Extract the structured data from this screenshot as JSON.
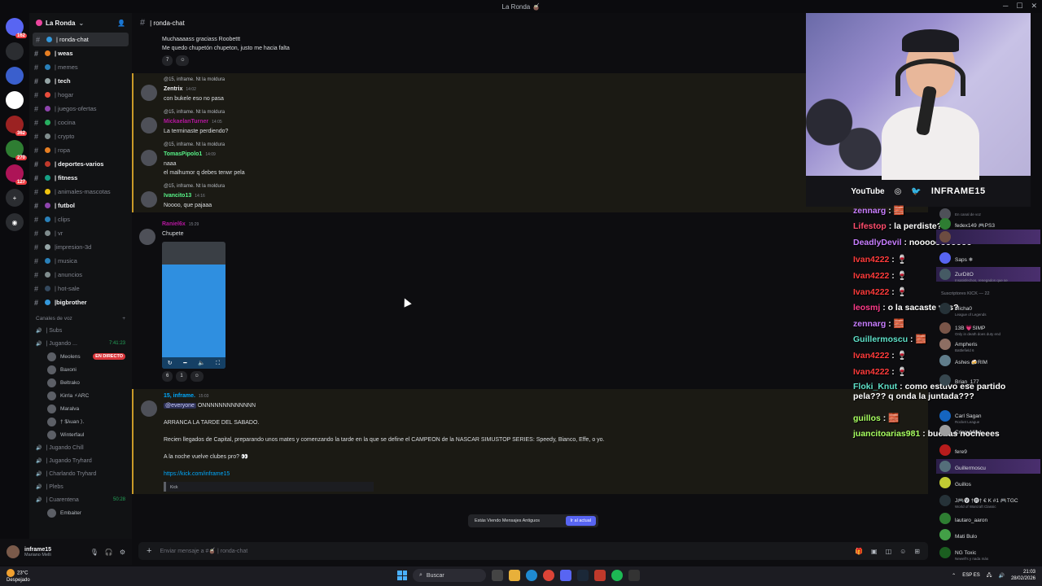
{
  "titlebar": {
    "title": "La Ronda 🧉"
  },
  "rail": {
    "servers": [
      {
        "badge": "162"
      },
      {
        "badge": ""
      },
      {
        "badge": ""
      },
      {
        "badge": ""
      },
      {
        "badge": "362"
      },
      {
        "badge": "270"
      },
      {
        "badge": "127"
      }
    ]
  },
  "sidebar": {
    "guild_name": "La Ronda",
    "channels": [
      {
        "label": "| ronda-chat",
        "state": "active"
      },
      {
        "label": "| weas",
        "state": "bold"
      },
      {
        "label": "| memes",
        "state": "muted"
      },
      {
        "label": "| tech",
        "state": "bold"
      },
      {
        "label": "| hogar",
        "state": "muted"
      },
      {
        "label": "| juegos-ofertas",
        "state": "muted"
      },
      {
        "label": "| cocina",
        "state": "muted"
      },
      {
        "label": "| crypto",
        "state": "muted"
      },
      {
        "label": "| ropa",
        "state": "muted"
      },
      {
        "label": "| deportes-varios",
        "state": "bold"
      },
      {
        "label": "| fitness",
        "state": "bold"
      },
      {
        "label": "| animales-mascotas",
        "state": "muted"
      },
      {
        "label": "| futbol",
        "state": "bold"
      },
      {
        "label": "| clips",
        "state": "muted"
      },
      {
        "label": "| vr",
        "state": "muted"
      },
      {
        "label": "|impresion-3d",
        "state": "muted"
      },
      {
        "label": "| musica",
        "state": "muted"
      },
      {
        "label": "| anuncios",
        "state": "muted"
      },
      {
        "label": "| hot-sale",
        "state": "muted"
      },
      {
        "label": "|bigbrother",
        "state": "bold"
      }
    ],
    "voice_header": "Canales de voz",
    "voice": [
      {
        "label": "| Subs",
        "kind": "channel"
      },
      {
        "label": "| Jugando ...",
        "kind": "channel",
        "timer": "7:41:23"
      },
      {
        "label": "Meolens",
        "kind": "user",
        "live": "EN DIRECTO"
      },
      {
        "label": "Baxoni",
        "kind": "user"
      },
      {
        "label": "Beltrako",
        "kind": "user"
      },
      {
        "label": "Kirrla ⚡ARC",
        "kind": "user"
      },
      {
        "label": "Maralva",
        "kind": "user"
      },
      {
        "label": "† $λuan ⟩.",
        "kind": "user"
      },
      {
        "label": "Winterfaul",
        "kind": "user"
      },
      {
        "label": "| Jugando Chill",
        "kind": "channel"
      },
      {
        "label": "| Jugando Tryhard",
        "kind": "channel"
      },
      {
        "label": "| Charlando Tryhard",
        "kind": "channel"
      },
      {
        "label": "| Plebs",
        "kind": "channel"
      },
      {
        "label": "| Cuarentena",
        "kind": "channel",
        "timer": "50:28"
      },
      {
        "label": "Embaiter",
        "kind": "user"
      }
    ]
  },
  "user_panel": {
    "name": "inframe15",
    "status": "Mariano Melli"
  },
  "chat": {
    "header": "| ronda-chat",
    "messages": [
      {
        "reply": "",
        "author": "",
        "time": "",
        "lines": [
          "Muchaaaass graciass Roobettt",
          "Me quedo chupetón chupeton, justo me hacia falta"
        ],
        "reacts": [
          "7"
        ],
        "hl": false
      },
      {
        "reply": "@15, inframe. Nt la moldura",
        "author": "Zentrix",
        "author_color": "#f2f3f5",
        "time": "14:02",
        "lines": [
          "con  bukele eso no pasa"
        ],
        "hl": true
      },
      {
        "reply": "@15, inframe. Nt la moldura",
        "author": "MickaelanTurner",
        "author_color": "#b5179e",
        "time": "14:05",
        "lines": [
          "La terminaste perdiendo?"
        ],
        "hl": true
      },
      {
        "reply": "@15, inframe. Nt la moldura",
        "author": "TomasPipolo1",
        "author_color": "#57f287",
        "time": "14:09",
        "lines": [
          "naaa",
          "el malhumor q debes tenwr pela"
        ],
        "hl": true
      },
      {
        "reply": "@15, inframe. Nt la moldura",
        "author": "Ivancito13",
        "author_color": "#57f287",
        "time": "14:16",
        "lines": [
          "Noooo, que pajaaa"
        ],
        "hl": true
      },
      {
        "reply": "",
        "author": "Raniel6x",
        "author_color": "#b5179e",
        "time": "15:29",
        "lines": [
          "Chupete"
        ],
        "reacts": [
          "6",
          "1"
        ],
        "image": true,
        "hl": false
      },
      {
        "reply": "",
        "author": "15, inframe.",
        "author_color": "#00a8fc",
        "time": "15:03",
        "mention": "@everyone",
        "lines": [
          "ONNNNNNNNNNNNN",
          "ARRANCA LA TARDE DEL SABADO.",
          "Recien llegados de Capital, preparando unos mates y comenzando la tarde en la que se define el CAMPEON de la NASCAR SIMUSTOP SERIES: Speedy, Bianco, Effe, o yo.",
          "A la noche vuelve clubes pro? 👀"
        ],
        "link": "https://kick.com/inframe15",
        "embed": "Kick",
        "hl": true
      }
    ],
    "jump": {
      "text": "Estás Viendo Mensajes Antiguos",
      "button": "Ir al actual"
    },
    "composer_placeholder": "Enviar mensaje a #🧉 | ronda-chat"
  },
  "overlay": {
    "socials": {
      "youtube": "YouTube",
      "handle": "INFRAME15"
    },
    "lines": [
      {
        "user": "zennarg",
        "user_color": "#c77dff",
        "text": ": 🧱"
      },
      {
        "user": "Lifestop",
        "user_color": "#ff4d6d",
        "text": ": la perdiste?"
      },
      {
        "user": "DeadlyDevil",
        "user_color": "#c77dff",
        "text": ": nooooooooooo"
      },
      {
        "user": "Ivan4222",
        "user_color": "#ff3b3b",
        "text": ": 🍷"
      },
      {
        "user": "Ivan4222",
        "user_color": "#ff3b3b",
        "text": ": 🍷"
      },
      {
        "user": "Ivan4222",
        "user_color": "#ff3b3b",
        "text": ": 🍷"
      },
      {
        "user": "leosmj",
        "user_color": "#ff3b8a",
        "text": ": o la sacaste vos?"
      },
      {
        "user": "zennarg",
        "user_color": "#c77dff",
        "text": ": 🧱"
      },
      {
        "user": "Guillermoscu",
        "user_color": "#5ee0c8",
        "text": ": 🧱"
      },
      {
        "user": "Ivan4222",
        "user_color": "#ff3b3b",
        "text": ": 🍷"
      },
      {
        "user": "Ivan4222",
        "user_color": "#ff3b3b",
        "text": ": 🍷"
      },
      {
        "user": "Floki_Knut",
        "user_color": "#5ee0c8",
        "text": ": como estuvo ese partido pela??? q onda la juntada???"
      },
      {
        "user": "guillos",
        "user_color": "#a8ff60",
        "text": ": 🧱"
      },
      {
        "user": "juancitoarias981",
        "user_color": "#a8ff60",
        "text": ": buenas nocheees"
      }
    ]
  },
  "members": {
    "section": "Suscriptores KICK — 22",
    "items": [
      {
        "name": "",
        "sub": "En canal de voz"
      },
      {
        "name": "fedex149 🎮PS3",
        "sub": ""
      },
      {
        "name": "",
        "sub": ""
      },
      {
        "name": "Saps ❄",
        "sub": ""
      },
      {
        "name": "ZurDitO",
        "sub": "Insatisfechos, renegados que se"
      },
      {
        "name": "Micha0",
        "sub": "League of Legends"
      },
      {
        "name": "13B 💗SIMP",
        "sub": "Only in death does duty end"
      },
      {
        "name": "Ampheris",
        "sub": "Battlefield 6"
      },
      {
        "name": "Ashes 🍻RIM",
        "sub": ""
      },
      {
        "name": "Brian_177",
        "sub": ""
      },
      {
        "name": "Carl Sagan",
        "sub": "Rocket League"
      },
      {
        "name": "CrispyMind",
        "sub": ""
      },
      {
        "name": "fere9",
        "sub": ""
      },
      {
        "name": "Guillermoscu",
        "sub": ""
      },
      {
        "name": "Guillos",
        "sub": ""
      },
      {
        "name": "J🎮🅥 †🅡† € K #1 🎮TGC",
        "sub": "World of Warcraft Classic"
      },
      {
        "name": "lautaro_aaron",
        "sub": ""
      },
      {
        "name": "Mati Bulo",
        "sub": ""
      },
      {
        "name": "NG Toxic",
        "sub": "Newell's y nada más"
      }
    ]
  },
  "taskbar": {
    "weather_temp": "23°C",
    "weather_desc": "Despejado",
    "search": "Buscar",
    "lang": "ESP ES",
    "time": "21:03",
    "date": "28/02/2026"
  },
  "colors": {
    "accent": "#5865f2",
    "highlight": "#c99a28",
    "live": "#da373c"
  }
}
